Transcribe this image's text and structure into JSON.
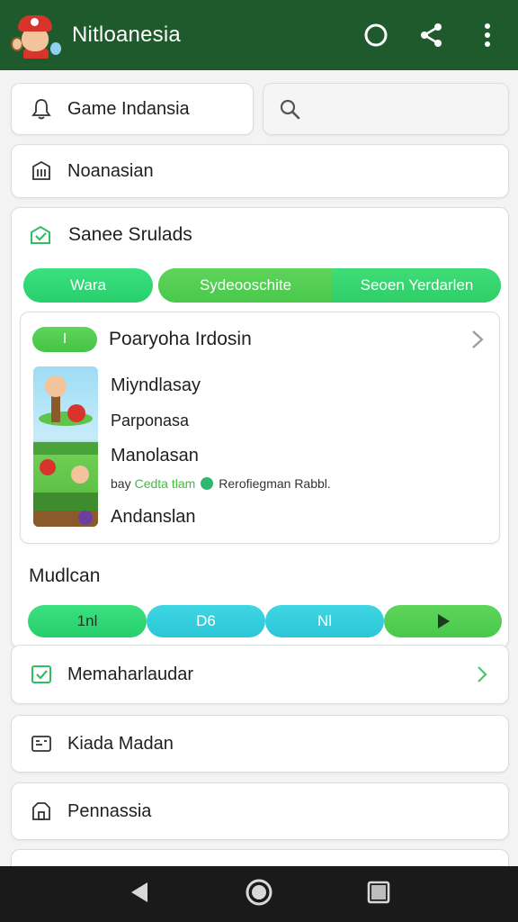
{
  "header": {
    "title": "Nitloanesia",
    "icons": [
      "circle-icon",
      "share-icon",
      "more-vert-icon"
    ],
    "color": "#1e5a2c"
  },
  "top_cards": {
    "game_label": "Game Indansia",
    "search_placeholder": ""
  },
  "row_noanasian": "Noanasian",
  "section1": {
    "title": "Sanee Srulads",
    "tabs": [
      "Wara",
      "Sydeooschite",
      "Seoen Yerdarlen"
    ]
  },
  "game_card": {
    "badge": "I",
    "title": "Poaryoha Irdosin",
    "lines": [
      "Miyndlasay",
      "Parponasa",
      "Manolasan"
    ],
    "meta_green": "Cedta tlam",
    "meta_prefix": "bay",
    "meta_suffix": "Rerofiegman Rabbl.",
    "last_line": "Andanslan"
  },
  "section2": {
    "title": "Mudlcan",
    "buttons": [
      "1nl",
      "D6",
      "Nl"
    ]
  },
  "rows": [
    "Memaharlaudar",
    "Kiada Madan",
    "Pennassia"
  ],
  "colors": {
    "accent_green": "#27cf6c",
    "cyan": "#2cc6d8",
    "lime": "#49c94b"
  }
}
